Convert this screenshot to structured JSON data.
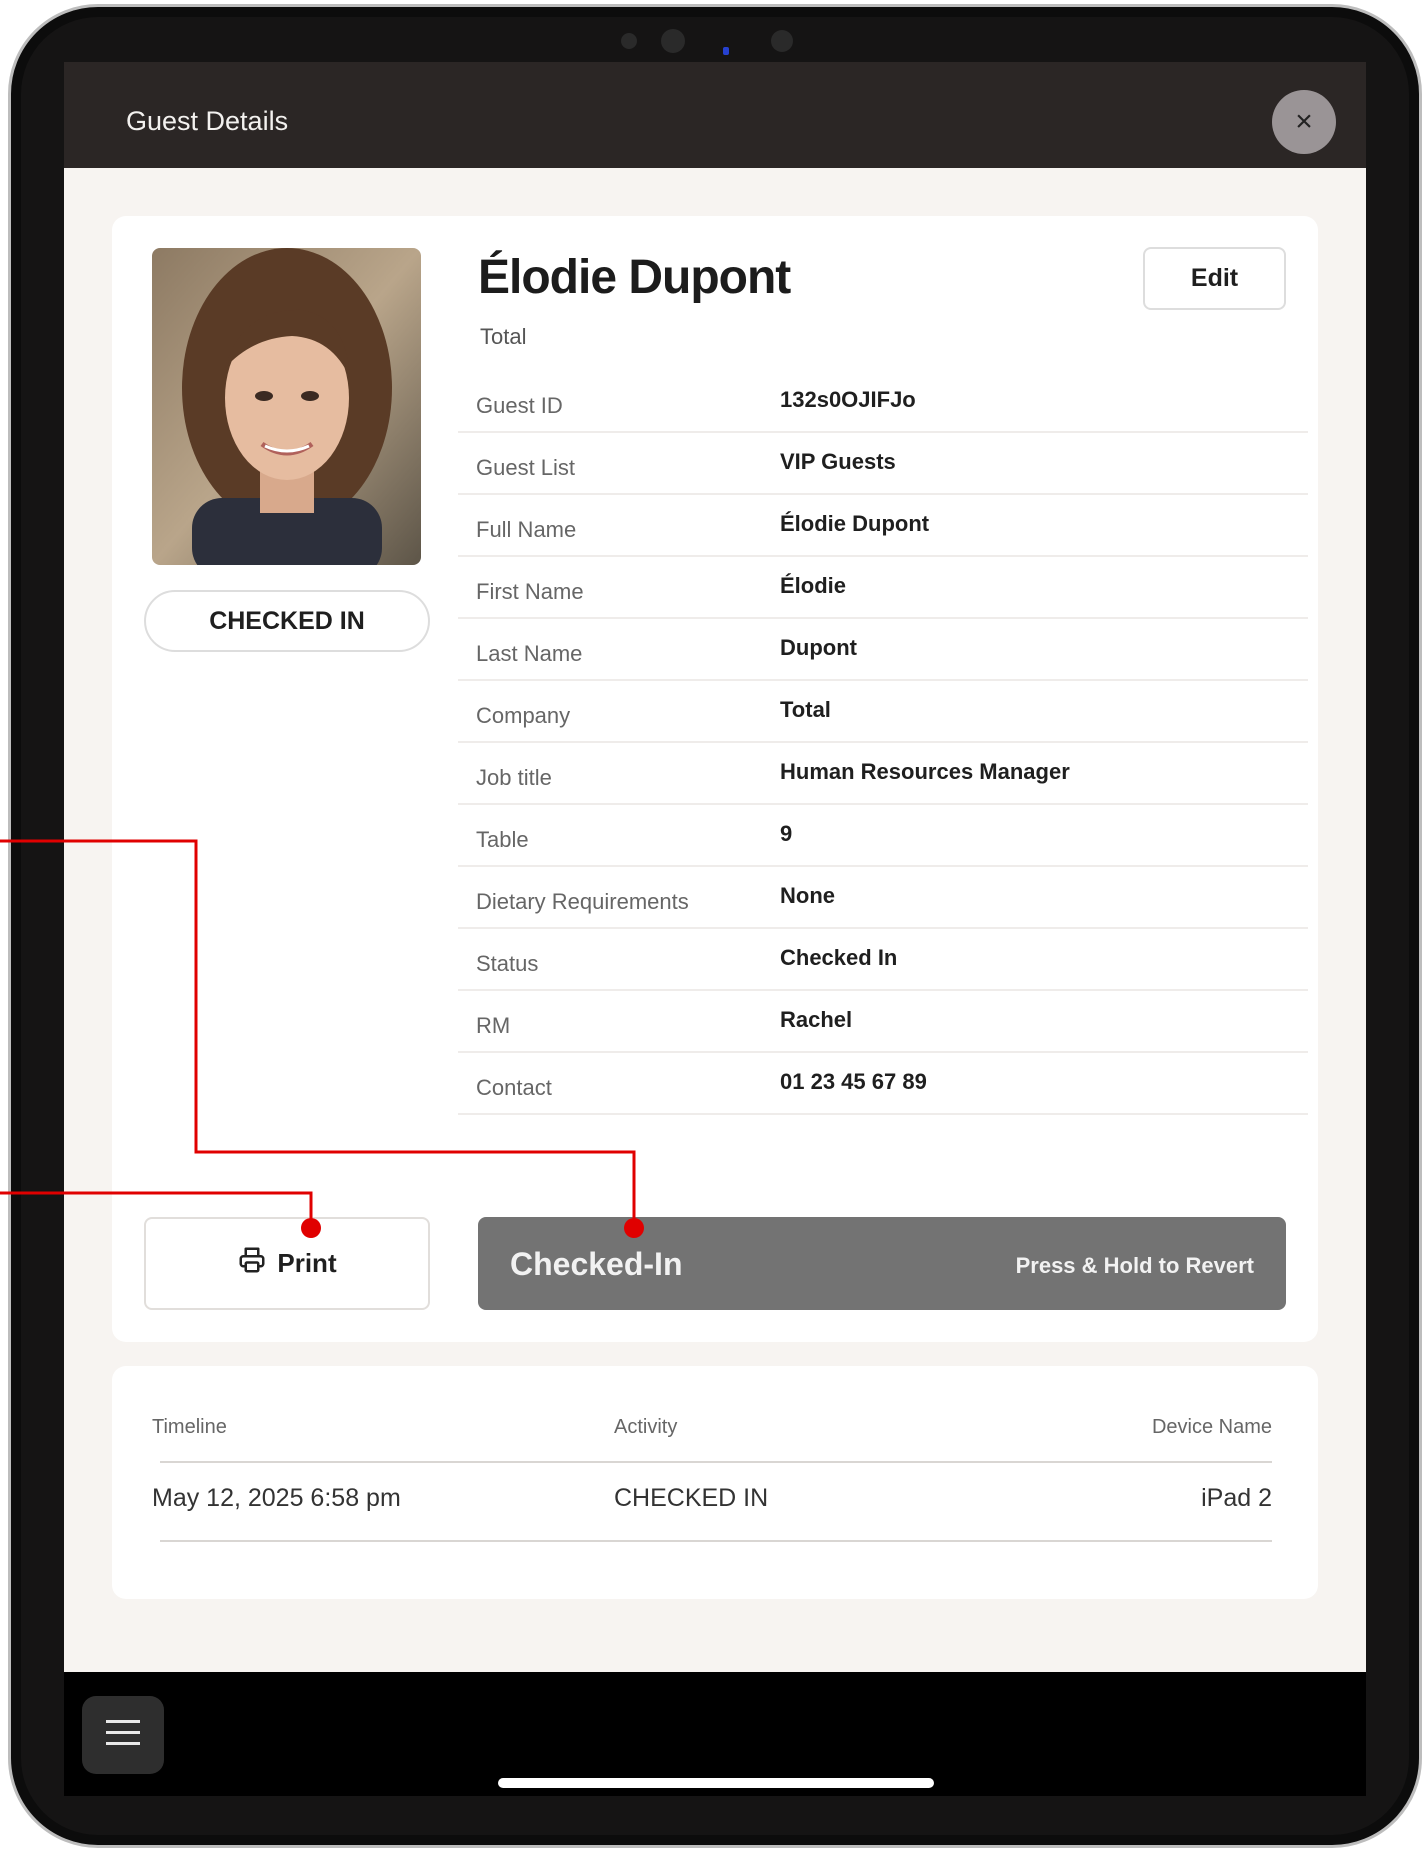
{
  "modal": {
    "title": "Guest Details",
    "close_label": "×"
  },
  "guest": {
    "name": "Élodie Dupont",
    "company": "Total",
    "status_pill": "CHECKED IN",
    "edit_label": "Edit",
    "fields": [
      {
        "label": "Guest ID",
        "value": "132s0OJIFJo"
      },
      {
        "label": "Guest List",
        "value": "VIP Guests"
      },
      {
        "label": "Full Name",
        "value": "Élodie Dupont"
      },
      {
        "label": "First Name",
        "value": "Élodie"
      },
      {
        "label": "Last Name",
        "value": "Dupont"
      },
      {
        "label": "Company",
        "value": "Total"
      },
      {
        "label": "Job title",
        "value": "Human Resources Manager"
      },
      {
        "label": "Table",
        "value": "9"
      },
      {
        "label": "Dietary Requirements",
        "value": "None"
      },
      {
        "label": "Status",
        "value": "Checked In"
      },
      {
        "label": "RM",
        "value": "Rachel"
      },
      {
        "label": "Contact",
        "value": "01 23 45 67 89"
      }
    ]
  },
  "actions": {
    "print_label": "Print",
    "checked_label": "Checked-In",
    "revert_hint": "Press & Hold to Revert"
  },
  "timeline": {
    "headers": [
      "Timeline",
      "Activity",
      "Device Name"
    ],
    "rows": [
      {
        "time": "May 12, 2025 6:58 pm",
        "activity": "CHECKED IN",
        "device": "iPad 2"
      }
    ]
  },
  "colors": {
    "header_bg": "#2b2625",
    "body_bg": "#f7f4f1",
    "checked_button": "#737373",
    "annotation": "#e00000"
  },
  "icons": {
    "close": "close-icon",
    "print": "printer-icon",
    "menu": "hamburger-menu-icon"
  }
}
